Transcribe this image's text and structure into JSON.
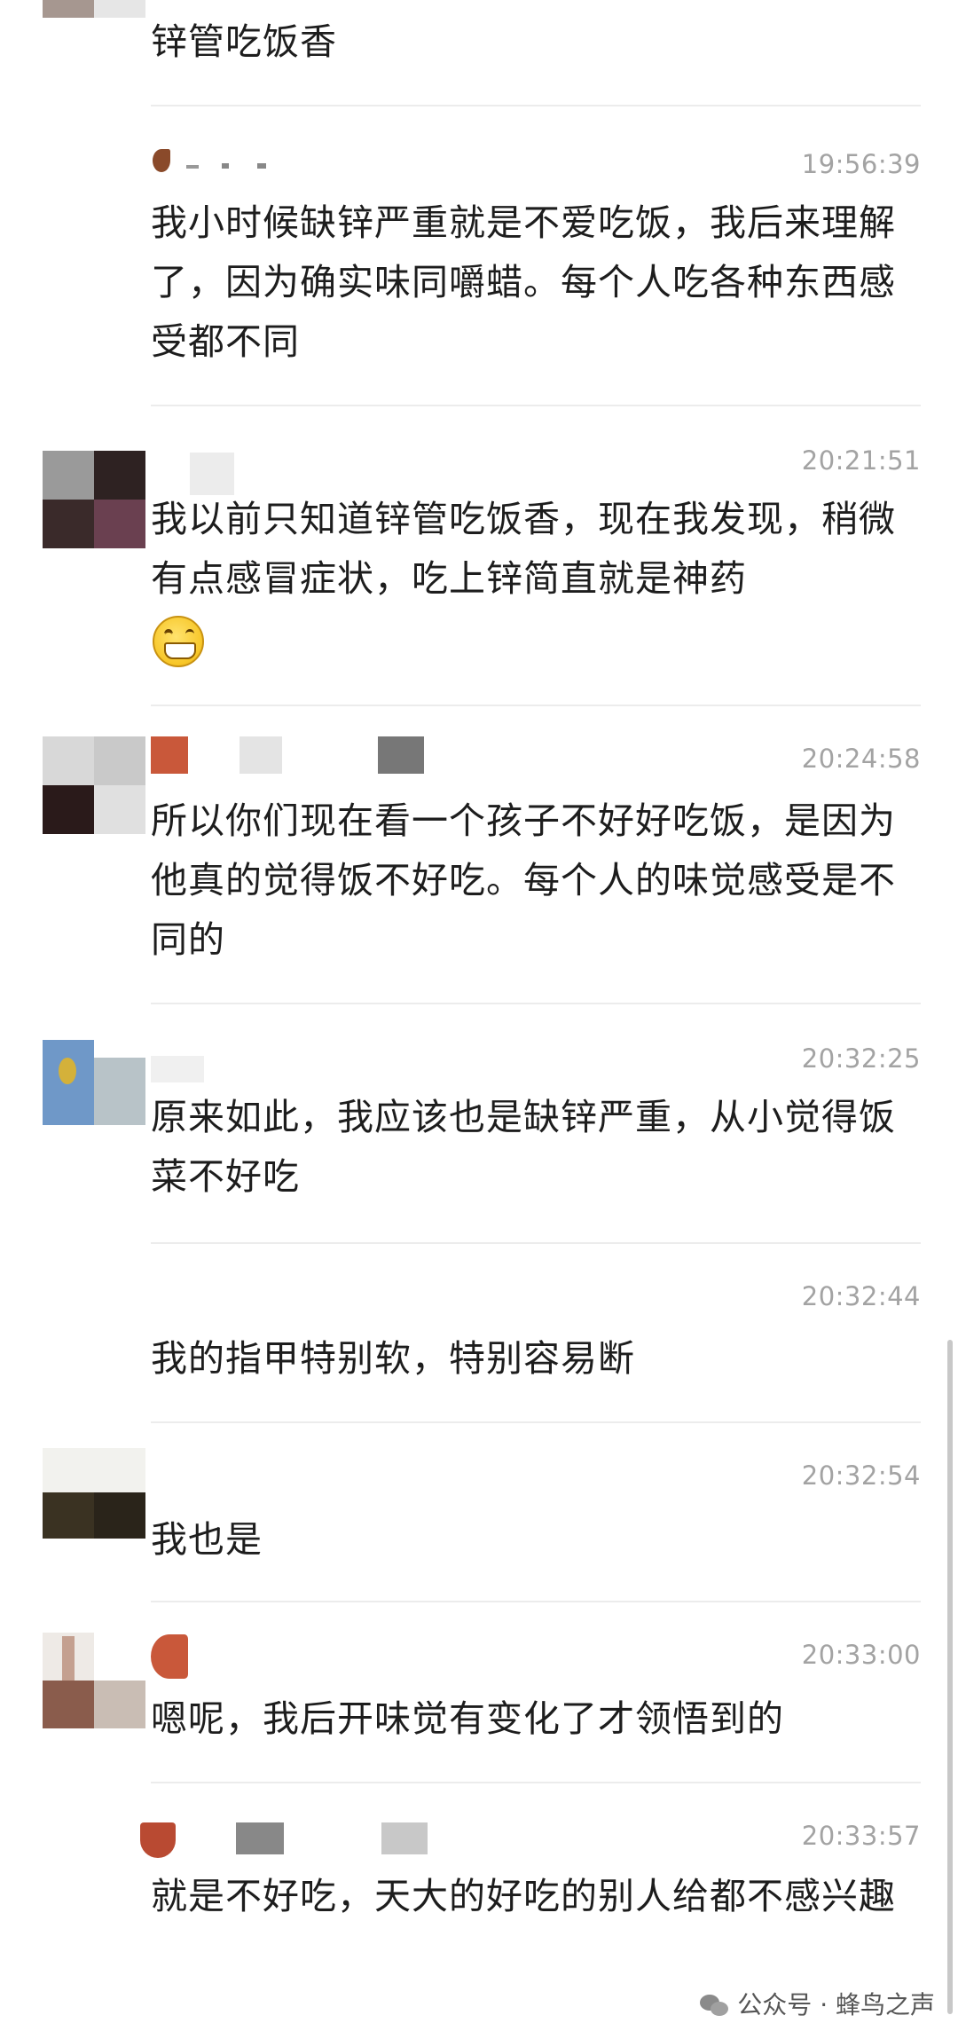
{
  "messages": [
    {
      "time": "",
      "text": "锌管吃饭香"
    },
    {
      "time": "19:56:39",
      "text": "我小时候缺锌严重就是不爱吃饭，我后来理解了，因为确实味同嚼蜡。每个人吃各种东西感受都不同"
    },
    {
      "time": "20:21:51",
      "text": "我以前只知道锌管吃饭香，现在我发现，稍微有点感冒症状，吃上锌简直就是神药",
      "emoji": "grinning-face-emoji"
    },
    {
      "time": "20:24:58",
      "text": "所以你们现在看一个孩子不好好吃饭，是因为他真的觉得饭不好吃。每个人的味觉感受是不同的"
    },
    {
      "time": "20:32:25",
      "text": "原来如此，我应该也是缺锌严重，从小觉得饭菜不好吃"
    },
    {
      "time": "20:32:44",
      "text": "我的指甲特别软，特别容易断"
    },
    {
      "time": "20:32:54",
      "text": "我也是"
    },
    {
      "time": "20:33:00",
      "text": "嗯呢，我后开味觉有变化了才领悟到的"
    },
    {
      "time": "20:33:57",
      "text": "就是不好吃，天大的好吃的别人给都不感兴趣"
    }
  ],
  "watermark": {
    "text": "公众号 · 蜂鸟之声",
    "icon": "wechat-icon"
  },
  "colors": {
    "time": "#a3a3a3",
    "text": "#1d1d1d",
    "divider": "#ececec"
  }
}
